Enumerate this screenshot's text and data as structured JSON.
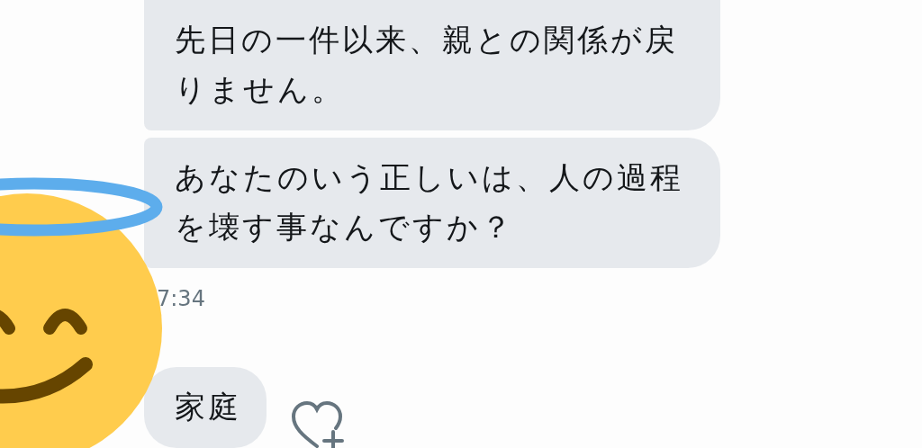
{
  "messages": [
    {
      "kind": "top",
      "text": "先日の一件以来、親との関係が戻りません。"
    },
    {
      "kind": "bottom",
      "text": "あなたのいう正しいは、人の過程を壊す事なんですか？"
    },
    {
      "kind": "time",
      "text": "7:34"
    },
    {
      "kind": "single",
      "text": "家庭",
      "reaction": true
    }
  ]
}
